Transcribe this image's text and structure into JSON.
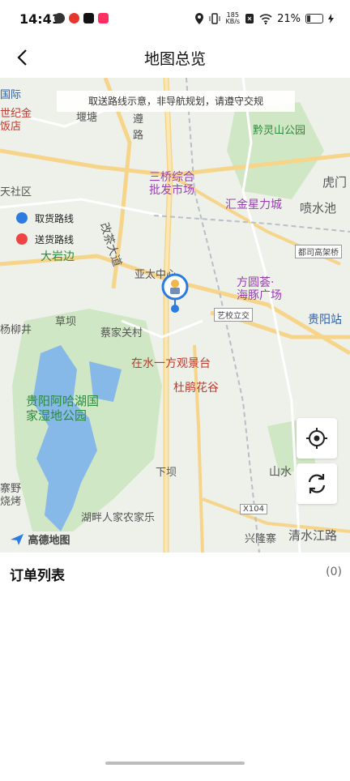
{
  "status_bar": {
    "time": "14:41",
    "net_speed_value": "185",
    "net_speed_unit": "KB/s",
    "battery": "21%"
  },
  "header": {
    "title": "地图总览"
  },
  "map": {
    "notice": "取送路线示意，非导航规划，请遵守交规",
    "legend": {
      "pickup": "取货路线",
      "delivery": "送货路线"
    },
    "pickup_color": "#2b7be0",
    "delivery_color": "#ef4444",
    "logo_text": "高德地图",
    "pois": [
      "国际",
      "世纪金",
      "饭店",
      "堰塘",
      "遵路",
      "黔灵山公园",
      "虎门",
      "喷水池",
      "汇金星力城",
      "三桥综合",
      "批发市场",
      "天社区",
      "大岩边",
      "改茶大道",
      "亚太中心",
      "方圆荟·",
      "海豚广场",
      "都司高架桥",
      "艺校立交",
      "贵阳站",
      "草坝",
      "蔡家关村",
      "杨柳井",
      "在水一方观景台",
      "杜鹃花谷",
      "贵阳阿哈湖国",
      "家湿地公园",
      "寨野",
      "烧烤",
      "湖畔人家农家乐",
      "下坝",
      "山水",
      "X104",
      "兴隆寨",
      "清水江路"
    ]
  },
  "orders": {
    "title": "订单列表",
    "count": "(0)"
  }
}
